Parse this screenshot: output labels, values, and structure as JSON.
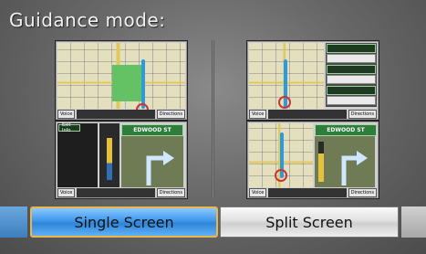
{
  "title": "Guidance mode:",
  "options": {
    "single_label": "Single Screen",
    "split_label": "Split Screen"
  },
  "previews": {
    "voice_label": "Voice",
    "directions_label": "Directions",
    "street_name": "EDWOOD ST",
    "exit_info_label": "Exit Info"
  },
  "colors": {
    "selected": "#3f98ea",
    "selected_border": "#e8b84a",
    "unselected": "#dcdcdc",
    "street_header": "#2e7d3a"
  }
}
